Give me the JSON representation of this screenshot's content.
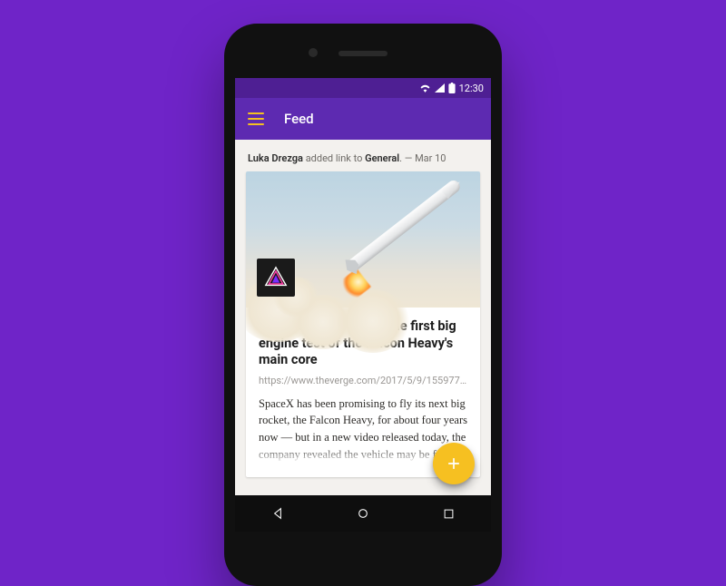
{
  "status": {
    "time": "12:30"
  },
  "appbar": {
    "title": "Feed"
  },
  "post": {
    "author": "Luka Drezga",
    "action_text": "added link to",
    "channel": "General",
    "separator": ". —",
    "date": "Mar 10",
    "headline": "Watch SpaceX fire up the first big engine test of the Falcon Heavy's main core",
    "url": "https://www.theverge.com/2017/5/9/15597756...",
    "excerpt": "SpaceX has been promising to fly its next big rocket, the Falcon Heavy, for about four years now — but in a new video released today, the company revealed the vehicle may be finally getting ready for its maid...",
    "source_badge_name": "verge-logo"
  },
  "fab": {
    "label": "+"
  },
  "colors": {
    "page_bg": "#6f24c8",
    "statusbar_bg": "#4e1f93",
    "appbar_bg": "#5d2ab1",
    "hamburger": "#f4c022",
    "fab": "#f6c021"
  }
}
